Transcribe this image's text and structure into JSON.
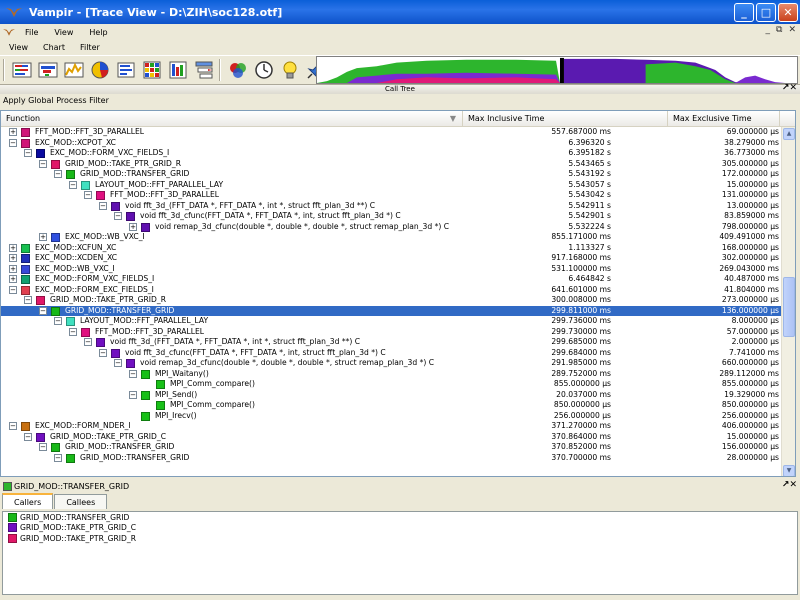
{
  "window": {
    "title": "Vampir - [Trace View - D:\\ZIH\\soc128.otf]",
    "minimize": "_",
    "maximize": "□",
    "close": "✕"
  },
  "menu": {
    "items": [
      "File",
      "View",
      "Help"
    ],
    "controls": [
      "_",
      "⧉",
      "✕"
    ]
  },
  "menu2": {
    "items": [
      "View",
      "Chart",
      "Filter"
    ]
  },
  "toolbar": {
    "icons": [
      "master-timeline-icon",
      "process-timeline-icon",
      "counter-timeline-icon",
      "function-summary-icon",
      "message-summary-icon",
      "communication-matrix-icon",
      "io-summary-icon",
      "call-tree-icon",
      "process-summary-icon",
      "clock-icon",
      "lightbulb-icon",
      "pin-icon"
    ]
  },
  "panel": {
    "title": "Call Tree",
    "corner": "↗✕"
  },
  "filter": {
    "label": "Apply Global Process Filter"
  },
  "columns": {
    "function": "Function",
    "max_incl": "Max Inclusive Time",
    "max_excl": "Max Exclusive Time",
    "sort": "▼"
  },
  "rows": [
    {
      "indent": 0,
      "exp": "+",
      "color": "#d01478",
      "name": "FFT_MOD::FFT_3D_PARALLEL",
      "incl": "557.687000 ms",
      "excl": "69.000000 µs"
    },
    {
      "indent": 0,
      "exp": "−",
      "color": "#d01478",
      "name": "EXC_MOD::XCPOT_XC",
      "incl": "6.396320 s",
      "excl": "38.279000 ms"
    },
    {
      "indent": 1,
      "exp": "−",
      "color": "#0a0aa0",
      "name": "EXC_MOD::FORM_VXC_FIELDS_I",
      "incl": "6.395182 s",
      "excl": "36.773000 ms"
    },
    {
      "indent": 2,
      "exp": "−",
      "color": "#e01868",
      "name": "GRID_MOD::TAKE_PTR_GRID_R",
      "incl": "5.543465 s",
      "excl": "305.000000 µs"
    },
    {
      "indent": 3,
      "exp": "−",
      "color": "#18b818",
      "name": "GRID_MOD::TRANSFER_GRID",
      "incl": "5.543192 s",
      "excl": "172.000000 µs"
    },
    {
      "indent": 4,
      "exp": "−",
      "color": "#40e0c0",
      "name": "LAYOUT_MOD::FFT_PARALLEL_LAY",
      "incl": "5.543057 s",
      "excl": "15.000000 µs"
    },
    {
      "indent": 5,
      "exp": "−",
      "color": "#e01080",
      "name": "FFT_MOD::FFT_3D_PARALLEL",
      "incl": "5.543042 s",
      "excl": "131.000000 µs"
    },
    {
      "indent": 6,
      "exp": "−",
      "color": "#6010b0",
      "name": "void fft_3d_(FFT_DATA *, FFT_DATA *, int *, struct fft_plan_3d **) C",
      "incl": "5.542911 s",
      "excl": "13.000000 µs"
    },
    {
      "indent": 7,
      "exp": "−",
      "color": "#6010b0",
      "name": "void fft_3d_cfunc(FFT_DATA *, FFT_DATA *, int, struct fft_plan_3d *) C",
      "incl": "5.542901 s",
      "excl": "83.859000 ms"
    },
    {
      "indent": 8,
      "exp": "+",
      "color": "#6010b0",
      "name": "void remap_3d_cfunc(double *, double *, double *, struct remap_plan_3d *) C",
      "incl": "5.532224 s",
      "excl": "798.000000 µs"
    },
    {
      "indent": 2,
      "exp": "+",
      "color": "#3050e0",
      "name": "EXC_MOD::WB_VXC_I",
      "incl": "855.171000 ms",
      "excl": "409.491000 ms"
    },
    {
      "indent": 0,
      "exp": "+",
      "color": "#18c050",
      "name": "EXC_MOD::XCFUN_XC",
      "incl": "1.113327 s",
      "excl": "168.000000 µs"
    },
    {
      "indent": 0,
      "exp": "+",
      "color": "#2030b8",
      "name": "EXC_MOD::XCDEN_XC",
      "incl": "917.168000 ms",
      "excl": "302.000000 µs"
    },
    {
      "indent": 0,
      "exp": "+",
      "color": "#3848d8",
      "name": "EXC_MOD::WB_VXC_I",
      "incl": "531.100000 ms",
      "excl": "269.043000 ms"
    },
    {
      "indent": 0,
      "exp": "+",
      "color": "#10a070",
      "name": "EXC_MOD::FORM_VXC_FIELDS_I",
      "incl": "6.464842 s",
      "excl": "40.487000 ms"
    },
    {
      "indent": 0,
      "exp": "−",
      "color": "#e04050",
      "name": "EXC_MOD::FORM_EXC_FIELDS_I",
      "incl": "641.601000 ms",
      "excl": "41.804000 ms"
    },
    {
      "indent": 1,
      "exp": "−",
      "color": "#e01868",
      "name": "GRID_MOD::TAKE_PTR_GRID_R",
      "incl": "300.008000 ms",
      "excl": "273.000000 µs"
    },
    {
      "indent": 2,
      "exp": "−",
      "color": "#18b818",
      "name": "GRID_MOD::TRANSFER_GRID",
      "incl": "299.811000 ms",
      "excl": "136.000000 µs",
      "sel": true
    },
    {
      "indent": 3,
      "exp": "−",
      "color": "#40e0c0",
      "name": "LAYOUT_MOD::FFT_PARALLEL_LAY",
      "incl": "299.736000 ms",
      "excl": "8.000000 µs"
    },
    {
      "indent": 4,
      "exp": "−",
      "color": "#e01080",
      "name": "FFT_MOD::FFT_3D_PARALLEL",
      "incl": "299.730000 ms",
      "excl": "57.000000 µs"
    },
    {
      "indent": 5,
      "exp": "−",
      "color": "#7010c0",
      "name": "void fft_3d_(FFT_DATA *, FFT_DATA *, int *, struct fft_plan_3d **) C",
      "incl": "299.685000 ms",
      "excl": "2.000000 µs"
    },
    {
      "indent": 6,
      "exp": "−",
      "color": "#7010c0",
      "name": "void fft_3d_cfunc(FFT_DATA *, FFT_DATA *, int, struct fft_plan_3d *) C",
      "incl": "299.684000 ms",
      "excl": "7.741000 ms"
    },
    {
      "indent": 7,
      "exp": "−",
      "color": "#7010c0",
      "name": "void remap_3d_cfunc(double *, double *, double *, struct remap_plan_3d *) C",
      "incl": "291.985000 ms",
      "excl": "660.000000 µs"
    },
    {
      "indent": 8,
      "exp": "−",
      "color": "#18c018",
      "name": "MPI_Waitany()",
      "incl": "289.752000 ms",
      "excl": "289.112000 ms"
    },
    {
      "indent": 9,
      "exp": "",
      "color": "#18c018",
      "name": "MPI_Comm_compare()",
      "incl": "855.000000 µs",
      "excl": "855.000000 µs"
    },
    {
      "indent": 8,
      "exp": "−",
      "color": "#18c018",
      "name": "MPI_Send()",
      "incl": "20.037000 ms",
      "excl": "19.329000 ms"
    },
    {
      "indent": 9,
      "exp": "",
      "color": "#18c018",
      "name": "MPI_Comm_compare()",
      "incl": "850.000000 µs",
      "excl": "850.000000 µs"
    },
    {
      "indent": 8,
      "exp": "",
      "color": "#18c018",
      "name": "MPI_Irecv()",
      "incl": "256.000000 µs",
      "excl": "256.000000 µs"
    },
    {
      "indent": 0,
      "exp": "−",
      "color": "#c87010",
      "name": "EXC_MOD::FORM_NDER_I",
      "incl": "371.270000 ms",
      "excl": "406.000000 µs"
    },
    {
      "indent": 1,
      "exp": "−",
      "color": "#7010c0",
      "name": "GRID_MOD::TAKE_PTR_GRID_C",
      "incl": "370.864000 ms",
      "excl": "15.000000 µs"
    },
    {
      "indent": 2,
      "exp": "−",
      "color": "#18b818",
      "name": "GRID_MOD::TRANSFER_GRID",
      "incl": "370.852000 ms",
      "excl": "156.000000 µs"
    },
    {
      "indent": 3,
      "exp": "−",
      "color": "#18b818",
      "name": "GRID_MOD::TRANSFER_GRID",
      "incl": "370.700000 ms",
      "excl": "28.000000 µs"
    }
  ],
  "bottom": {
    "selected": "GRID_MOD::TRANSFER_GRID",
    "corner": "↗✕",
    "tabs": [
      "Callers",
      "Callees"
    ],
    "callers": [
      {
        "color": "#18b818",
        "name": "GRID_MOD::TRANSFER_GRID"
      },
      {
        "color": "#7010c0",
        "name": "GRID_MOD::TAKE_PTR_GRID_C"
      },
      {
        "color": "#e01868",
        "name": "GRID_MOD::TAKE_PTR_GRID_R"
      }
    ]
  }
}
